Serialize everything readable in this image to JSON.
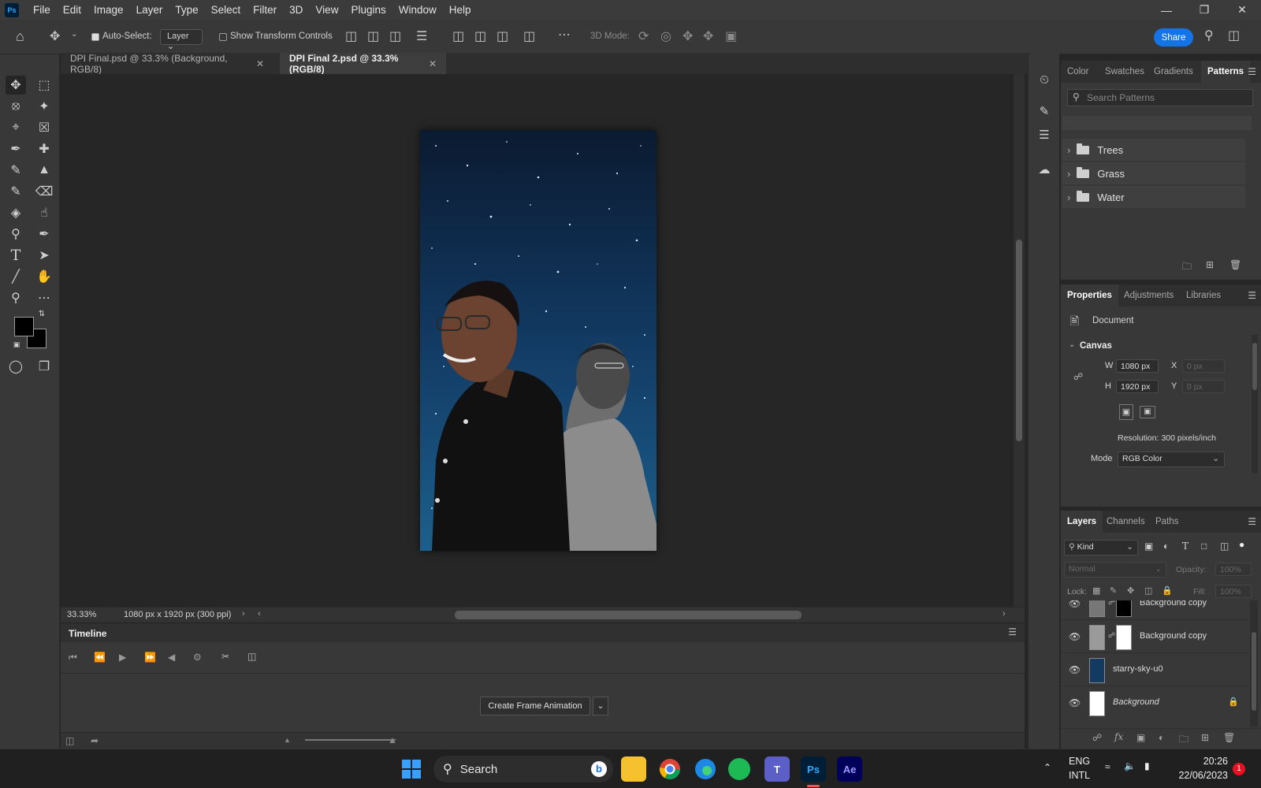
{
  "menubar": {
    "logo": "Ps",
    "items": [
      "File",
      "Edit",
      "Image",
      "Layer",
      "Type",
      "Select",
      "Filter",
      "3D",
      "View",
      "Plugins",
      "Window",
      "Help"
    ]
  },
  "options": {
    "auto_select_label": "Auto-Select:",
    "auto_select_value": "Layer",
    "show_transform_label": "Show Transform Controls",
    "mode_3d_label": "3D Mode:",
    "share_label": "Share"
  },
  "tabs": [
    {
      "label": "DPI Final.psd @ 33.3% (Background, RGB/8)",
      "active": false
    },
    {
      "label": "DPI Final 2.psd @ 33.3% (RGB/8)",
      "active": true
    }
  ],
  "status": {
    "zoom": "33.33%",
    "doc_info": "1080 px x 1920 px (300 ppi)"
  },
  "timeline": {
    "title": "Timeline",
    "create_button": "Create Frame Animation"
  },
  "patterns_panel": {
    "tabs": [
      "Color",
      "Swatches",
      "Gradients",
      "Patterns"
    ],
    "active_tab": "Patterns",
    "search_placeholder": "Search Patterns",
    "folders": [
      "Trees",
      "Grass",
      "Water"
    ]
  },
  "properties_panel": {
    "tabs": [
      "Properties",
      "Adjustments",
      "Libraries"
    ],
    "active_tab": "Properties",
    "doc_label": "Document",
    "section": "Canvas",
    "w_label": "W",
    "w_value": "1080 px",
    "h_label": "H",
    "h_value": "1920 px",
    "x_label": "X",
    "x_value": "0 px",
    "y_label": "Y",
    "y_value": "0 px",
    "resolution": "Resolution: 300 pixels/inch",
    "mode_label": "Mode",
    "mode_value": "RGB Color"
  },
  "layers_panel": {
    "tabs": [
      "Layers",
      "Channels",
      "Paths"
    ],
    "active_tab": "Layers",
    "filter_kind": "Kind",
    "blend_mode": "Normal",
    "opacity_label": "Opacity:",
    "opacity_value": "100%",
    "lock_label": "Lock:",
    "fill_label": "Fill:",
    "fill_value": "100%",
    "layers": [
      {
        "name": "Background copy",
        "visible": true
      },
      {
        "name": "Background copy",
        "visible": true
      },
      {
        "name": "starry-sky-u0",
        "visible": true
      },
      {
        "name": "Background",
        "visible": true,
        "locked": true
      }
    ]
  },
  "taskbar": {
    "search_label": "Search",
    "lang_top": "ENG",
    "lang_bottom": "INTL",
    "time": "20:26",
    "date": "22/06/2023",
    "notification_count": "1",
    "apps": [
      "Ps",
      "Ae"
    ]
  },
  "colors": {
    "accent": "#1473e6",
    "ps_blue": "#31a8ff",
    "ae_purple": "#9999ff",
    "notification_red": "#e81123"
  }
}
